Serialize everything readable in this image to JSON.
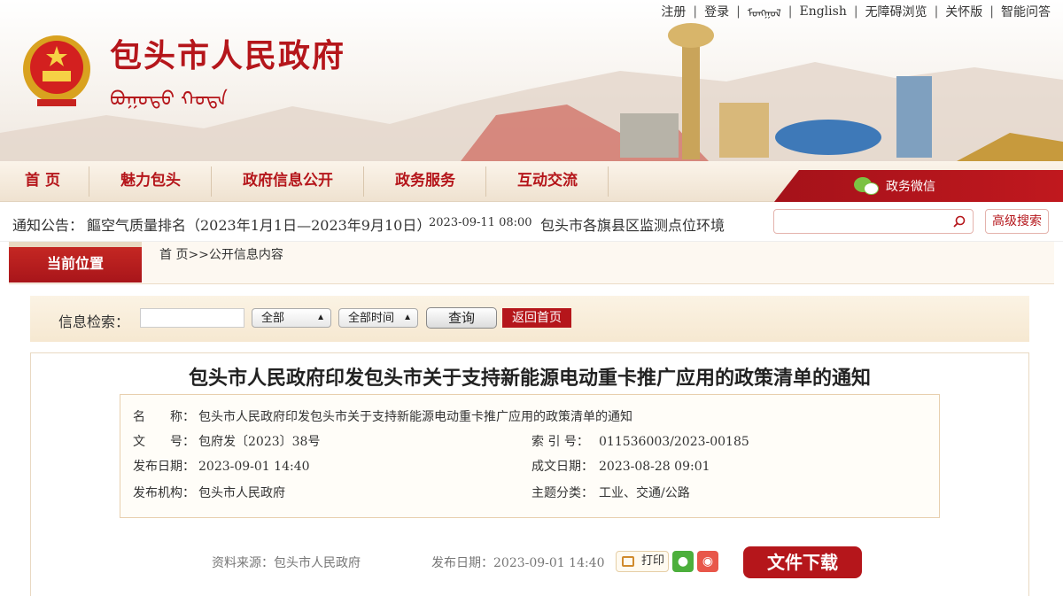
{
  "header": {
    "site_title": "包头市人民政府",
    "mongol_title": "ᠪᠣᠭᠣᠲᠣ ᠬᠣᠲᠠ",
    "top_links": [
      "注册",
      "登录",
      "ᠮᠣᠩᠭᠣᠯ",
      "English",
      "无障碍浏览",
      "关怀版",
      "智能问答"
    ],
    "colors": {
      "brand_red": "#b5161b"
    }
  },
  "nav": {
    "items": [
      "首 页",
      "魅力包头",
      "政府信息公开",
      "政务服务",
      "互动交流"
    ],
    "wechat_label": "政务微信"
  },
  "notice": {
    "label": "通知公告：",
    "text1": "饇空气质量排名（2023年1月1日—2023年9月10日）",
    "date1": "2023-09-11 08:00",
    "text2": "包头市各旗县区监测点位环境"
  },
  "search": {
    "placeholder": "",
    "advanced_label": "高级搜索"
  },
  "breadcrumb": {
    "label": "当前位置",
    "path": "首 页>>公开信息内容"
  },
  "filter": {
    "label": "信息检索：",
    "input_value": "",
    "category_selected": "全部",
    "time_selected": "全部时间",
    "query_button": "查询",
    "back_button": "返回首页"
  },
  "article": {
    "title": "包头市人民政府印发包头市关于支持新能源电动重卡推广应用的政策清单的通知",
    "meta": {
      "name_key": "名　　称：",
      "name_value": "包头市人民政府印发包头市关于支持新能源电动重卡推广应用的政策清单的通知",
      "doc_no_key": "文　　号：",
      "doc_no_value": "包府发〔2023〕38号",
      "index_key": "索 引 号：",
      "index_value": "011536003/2023-00185",
      "pub_date_key": "发布日期：",
      "pub_date_value": "2023-09-01 14:40",
      "created_key": "成文日期：",
      "created_value": "2023-08-28 09:01",
      "org_key": "发布机构：",
      "org_value": "包头市人民政府",
      "topic_key": "主题分类：",
      "topic_value": "工业、交通/公路"
    },
    "footer": {
      "source": "资料来源：包头市人民政府",
      "pub_date": "发布日期：2023-09-01 14:40",
      "print_label": "打印",
      "download_label": "文件下载"
    }
  }
}
